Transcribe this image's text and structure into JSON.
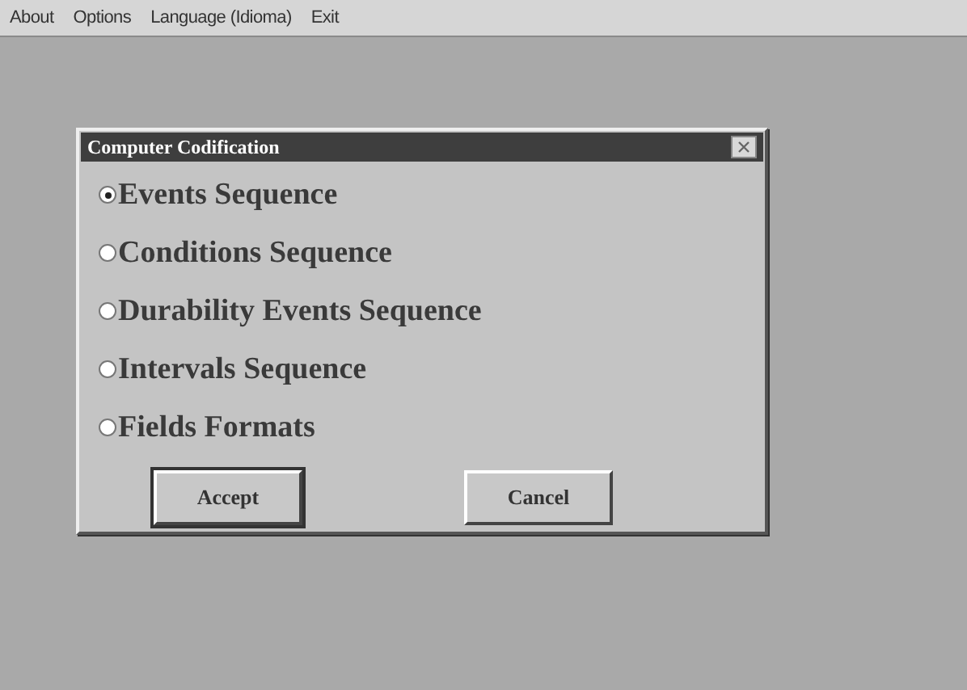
{
  "menu_bar": [
    {
      "label": "About"
    },
    {
      "label": "Options"
    },
    {
      "label": "Language (Idioma)"
    },
    {
      "label": "Exit"
    }
  ],
  "dialog": {
    "title": "Computer Codification",
    "options": [
      {
        "label": "Events Sequence",
        "selected": true
      },
      {
        "label": "Conditions Sequence",
        "selected": false
      },
      {
        "label": "Durability Events Sequence",
        "selected": false
      },
      {
        "label": "Intervals Sequence",
        "selected": false
      },
      {
        "label": "Fields Formats",
        "selected": false
      }
    ],
    "buttons": [
      {
        "label": "Accept",
        "default": true
      },
      {
        "label": "Cancel",
        "default": false
      }
    ]
  }
}
